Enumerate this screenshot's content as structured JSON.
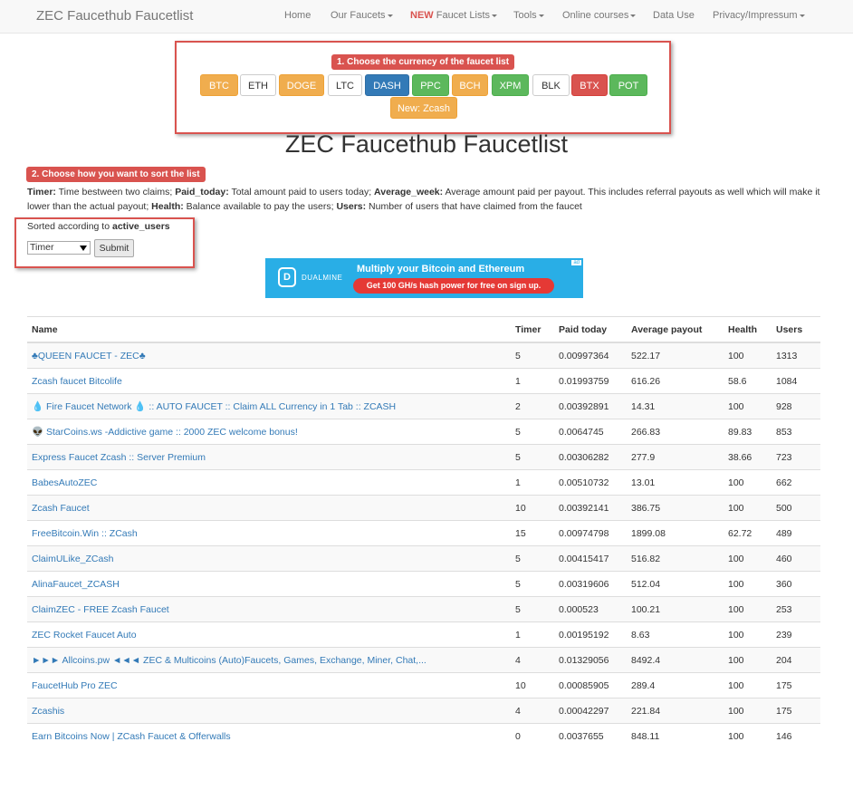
{
  "nav": {
    "brand": "ZEC Faucethub Faucetlist",
    "items": [
      {
        "label": "Home",
        "dropdown": false
      },
      {
        "label": "Our Faucets",
        "dropdown": true
      },
      {
        "label_new": "NEW",
        "label": " Faucet Lists",
        "dropdown": true
      },
      {
        "label": "Tools",
        "dropdown": true
      },
      {
        "label": "Online courses",
        "dropdown": true
      },
      {
        "label": "Data Use",
        "dropdown": false
      },
      {
        "label": "Privacy/Impressum",
        "dropdown": true
      }
    ]
  },
  "currency": {
    "step_label": "1. Choose the currency of the faucet list",
    "buttons": [
      {
        "label": "BTC",
        "style": "warning"
      },
      {
        "label": "ETH",
        "style": "default"
      },
      {
        "label": "DOGE",
        "style": "warning"
      },
      {
        "label": "LTC",
        "style": "default"
      },
      {
        "label": "DASH",
        "style": "primary"
      },
      {
        "label": "PPC",
        "style": "success"
      },
      {
        "label": "BCH",
        "style": "warning"
      },
      {
        "label": "XPM",
        "style": "success"
      },
      {
        "label": "BLK",
        "style": "default"
      },
      {
        "label": "BTX",
        "style": "danger"
      },
      {
        "label": "POT",
        "style": "success"
      },
      {
        "label": "New: Zcash",
        "style": "warning"
      }
    ]
  },
  "page_title": "ZEC Faucethub Faucetlist",
  "sort": {
    "step_label": "2. Choose how you want to sort the list",
    "legend": [
      {
        "term": "Timer:",
        "desc": " Time bestween two claims; "
      },
      {
        "term": "Paid_today:",
        "desc": " Total amount paid to users today; "
      },
      {
        "term": "Average_week:",
        "desc": " Average amount paid per payout. This includes referral payouts as well which will make it lower than the actual payout; "
      },
      {
        "term": "Health:",
        "desc": " Balance available to pay the users; "
      },
      {
        "term": "Users:",
        "desc": " Number of users that have claimed from the faucet"
      }
    ],
    "sorted_prefix": "Sorted according to ",
    "sorted_value": "active_users",
    "select_value": "Timer",
    "submit_label": "Submit"
  },
  "banner": {
    "brand": "DUALMINE",
    "logo_letter": "D",
    "headline": "Multiply your Bitcoin and Ethereum",
    "cta": "Get 100 GH/s hash power for free on sign up.",
    "tag": "ad"
  },
  "table": {
    "columns": [
      "Name",
      "Timer",
      "Paid today",
      "Average payout",
      "Health",
      "Users"
    ],
    "rows": [
      {
        "name": "♣QUEEN FAUCET - ZEC♣",
        "timer": "5",
        "paid": "0.00997364",
        "avg": "522.17",
        "health": "100",
        "users": "1313",
        "timer_green": false
      },
      {
        "name": "Zcash faucet Bitcolife",
        "timer": "1",
        "paid": "0.01993759",
        "avg": "616.26",
        "health": "58.6",
        "users": "1084",
        "timer_green": true
      },
      {
        "name": "💧 Fire Faucet Network 💧 :: AUTO FAUCET :: Claim ALL Currency in 1 Tab :: ZCASH",
        "timer": "2",
        "paid": "0.00392891",
        "avg": "14.31",
        "health": "100",
        "users": "928",
        "timer_green": false
      },
      {
        "name": "👽 StarCoins.ws -Addictive game :: 2000 ZEC welcome bonus!",
        "timer": "5",
        "paid": "0.0064745",
        "avg": "266.83",
        "health": "89.83",
        "users": "853",
        "timer_green": false
      },
      {
        "name": "Express Faucet Zcash :: Server Premium",
        "timer": "5",
        "paid": "0.00306282",
        "avg": "277.9",
        "health": "38.66",
        "users": "723",
        "timer_green": false
      },
      {
        "name": "BabesAutoZEC",
        "timer": "1",
        "paid": "0.00510732",
        "avg": "13.01",
        "health": "100",
        "users": "662",
        "timer_green": true
      },
      {
        "name": "Zcash Faucet",
        "timer": "10",
        "paid": "0.00392141",
        "avg": "386.75",
        "health": "100",
        "users": "500",
        "timer_green": false
      },
      {
        "name": "FreeBitcoin.Win :: ZCash",
        "timer": "15",
        "paid": "0.00974798",
        "avg": "1899.08",
        "health": "62.72",
        "users": "489",
        "timer_green": false
      },
      {
        "name": "ClaimULike_ZCash",
        "timer": "5",
        "paid": "0.00415417",
        "avg": "516.82",
        "health": "100",
        "users": "460",
        "timer_green": false
      },
      {
        "name": "AlinaFaucet_ZCASH",
        "timer": "5",
        "paid": "0.00319606",
        "avg": "512.04",
        "health": "100",
        "users": "360",
        "timer_green": false
      },
      {
        "name": "ClaimZEC - FREE Zcash Faucet",
        "timer": "5",
        "paid": "0.000523",
        "avg": "100.21",
        "health": "100",
        "users": "253",
        "timer_green": false
      },
      {
        "name": "ZEC Rocket Faucet Auto",
        "timer": "1",
        "paid": "0.00195192",
        "avg": "8.63",
        "health": "100",
        "users": "239",
        "timer_green": true
      },
      {
        "name": "►►► Allcoins.pw ◄◄◄ ZEC & Multicoins (Auto)Faucets, Games, Exchange, Miner, Chat,...",
        "timer": "4",
        "paid": "0.01329056",
        "avg": "8492.4",
        "health": "100",
        "users": "204",
        "timer_green": false
      },
      {
        "name": "FaucetHub Pro ZEC",
        "timer": "10",
        "paid": "0.00085905",
        "avg": "289.4",
        "health": "100",
        "users": "175",
        "timer_green": false
      },
      {
        "name": "Zcashis",
        "timer": "4",
        "paid": "0.00042297",
        "avg": "221.84",
        "health": "100",
        "users": "175",
        "timer_green": false
      },
      {
        "name": "Earn Bitcoins Now | ZCash Faucet & Offerwalls",
        "timer": "0",
        "paid": "0.0037655",
        "avg": "848.11",
        "health": "100",
        "users": "146",
        "timer_green": false
      }
    ]
  }
}
